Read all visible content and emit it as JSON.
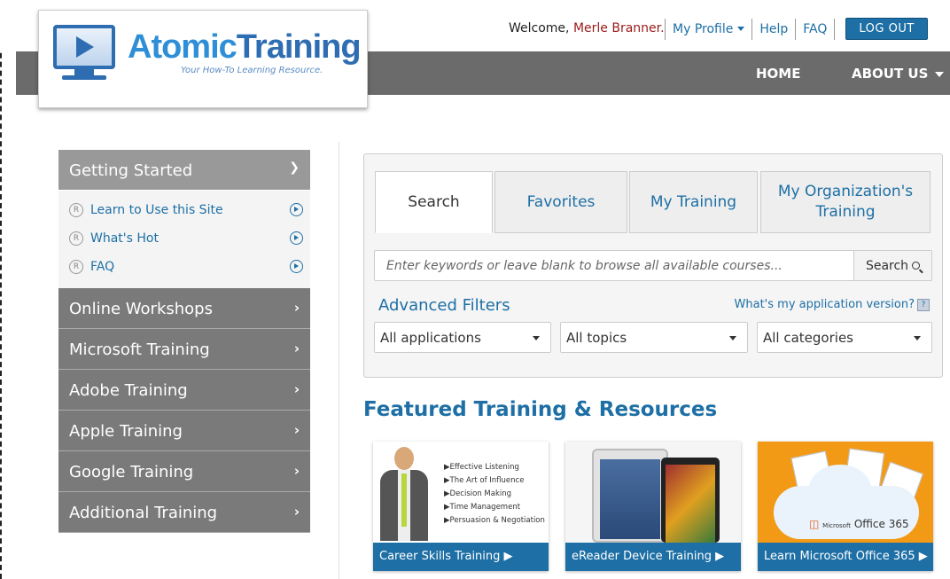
{
  "header": {
    "welcome_prefix": "Welcome,",
    "user_name": "Merle Branner.",
    "my_profile": "My Profile",
    "help": "Help",
    "faq": "FAQ",
    "logout": "LOG OUT"
  },
  "logo": {
    "name_part1": "Atomic",
    "name_part2": "Training",
    "tagline": "Your How-To Learning Resource."
  },
  "nav": {
    "home": "HOME",
    "about": "ABOUT US"
  },
  "sidebar": {
    "open_section": "Getting Started",
    "sub_items": [
      {
        "label": "Learn to Use this Site"
      },
      {
        "label": "What's Hot"
      },
      {
        "label": "FAQ"
      }
    ],
    "sections": [
      {
        "label": "Online Workshops"
      },
      {
        "label": "Microsoft Training"
      },
      {
        "label": "Adobe Training"
      },
      {
        "label": "Apple Training"
      },
      {
        "label": "Google Training"
      },
      {
        "label": "Additional Training"
      }
    ]
  },
  "search_panel": {
    "tabs": [
      {
        "label": "Search",
        "active": true
      },
      {
        "label": "Favorites",
        "active": false
      },
      {
        "label": "My Training",
        "active": false
      },
      {
        "label": "My Organization's Training",
        "active": false
      }
    ],
    "search_placeholder": "Enter keywords or leave blank to browse all available courses...",
    "search_value": "",
    "search_button": "Search",
    "advanced_filters": "Advanced Filters",
    "app_version_link": "What's my application version?",
    "filters": [
      {
        "selected": "All applications"
      },
      {
        "selected": "All topics"
      },
      {
        "selected": "All categories"
      }
    ]
  },
  "featured": {
    "title": "Featured Training & Resources",
    "cards": [
      {
        "caption": "Career Skills Training ▶",
        "bullets": [
          "▶Effective Listening",
          "▶The Art of Influence",
          "▶Decision Making",
          "▶Time Management",
          "▶Persuasion & Negotiation"
        ]
      },
      {
        "caption": "eReader Device Training ▶"
      },
      {
        "caption": "Learn Microsoft Office 365 ▶",
        "product_brand": "Microsoft",
        "product_name": "Office 365"
      }
    ]
  },
  "colors": {
    "brand_blue": "#1d6fa5",
    "nav_gray": "#6b6b6b",
    "sidebar_gray": "#7a7a7a",
    "user_red": "#9b1b1b"
  }
}
